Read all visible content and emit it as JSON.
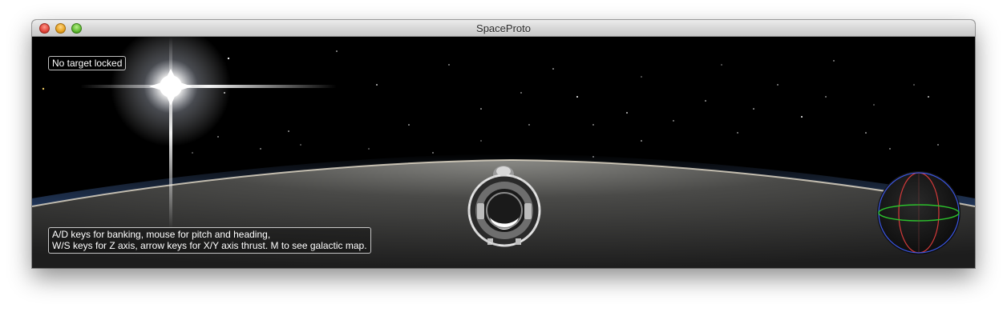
{
  "window": {
    "title": "SpaceProto",
    "controls": [
      "close",
      "minimize",
      "zoom"
    ]
  },
  "hud": {
    "target_status": "No target locked",
    "help_line_1": "A/D keys for banking, mouse for pitch and heading,",
    "help_line_2": "W/S keys for Z axis, arrow keys for X/Y axis thrust. M to see galactic map."
  },
  "scene": {
    "elements": [
      "sun-flare",
      "starfield",
      "planet-horizon",
      "player-spaceship",
      "orientation-gyroscope"
    ],
    "colors": {
      "space": "#000000",
      "horizon_glow": "#f1e6cf",
      "atmosphere_blue": "#2e69c9",
      "gyro_x_axis": "#e03030",
      "gyro_y_axis": "#2cc12c",
      "gyro_z_axis": "#3a5ae8"
    }
  }
}
